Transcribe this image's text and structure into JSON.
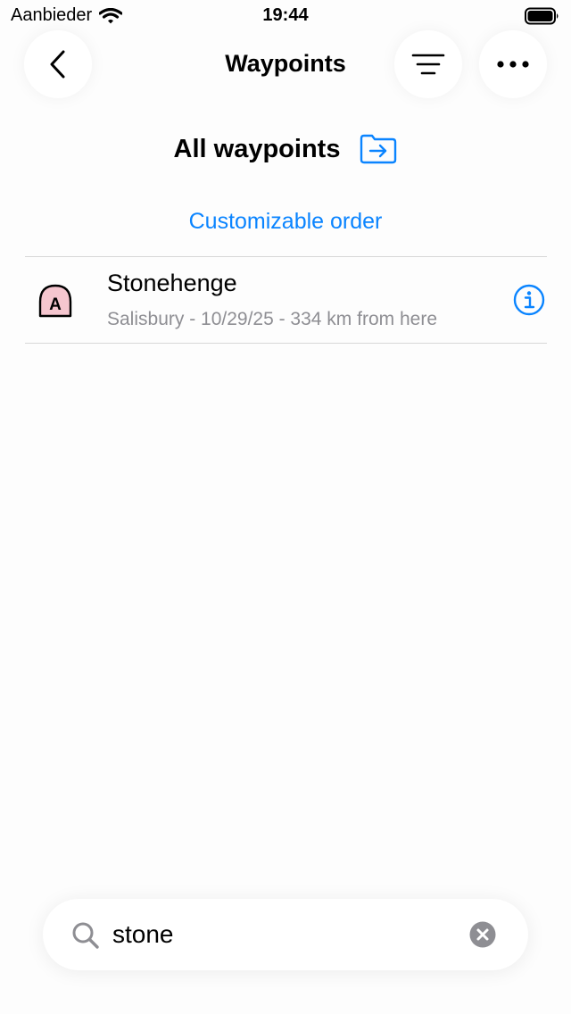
{
  "status_bar": {
    "carrier": "Aanbieder",
    "time": "19:44"
  },
  "nav": {
    "title": "Waypoints"
  },
  "folder": {
    "title": "All waypoints"
  },
  "sort": {
    "label": "Customizable order"
  },
  "waypoints": [
    {
      "icon_letter": "A",
      "name": "Stonehenge",
      "subtitle": "Salisbury - 10/29/25 - 334 km from here"
    }
  ],
  "search": {
    "value": "stone"
  },
  "colors": {
    "accent": "#0a84ff",
    "secondary_text": "#8e8e93",
    "waypoint_fill": "#f5c6cf"
  },
  "icons": [
    "wifi-icon",
    "battery-icon",
    "back-chevron-icon",
    "filter-icon",
    "more-icon",
    "folder-arrow-icon",
    "waypoint-marker-icon",
    "info-icon",
    "search-icon",
    "clear-icon"
  ]
}
